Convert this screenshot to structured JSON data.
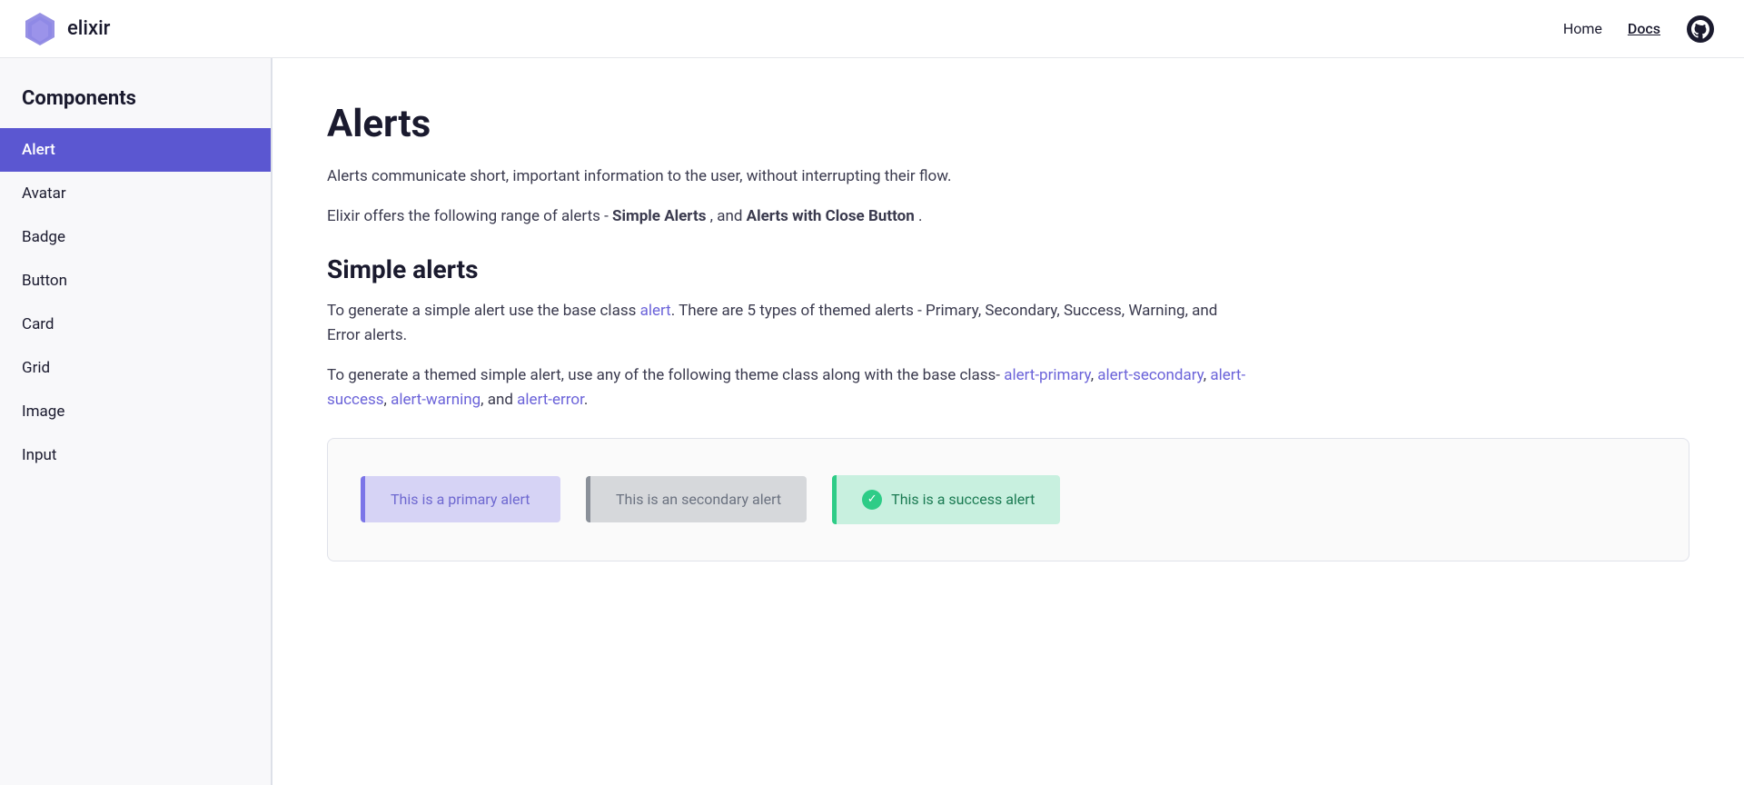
{
  "nav": {
    "logo_text": "elixir",
    "home_label": "Home",
    "docs_label": "Docs",
    "github_label": "GitHub"
  },
  "sidebar": {
    "heading": "Components",
    "items": [
      {
        "id": "alert",
        "label": "Alert",
        "active": true
      },
      {
        "id": "avatar",
        "label": "Avatar",
        "active": false
      },
      {
        "id": "badge",
        "label": "Badge",
        "active": false
      },
      {
        "id": "button",
        "label": "Button",
        "active": false
      },
      {
        "id": "card",
        "label": "Card",
        "active": false
      },
      {
        "id": "grid",
        "label": "Grid",
        "active": false
      },
      {
        "id": "image",
        "label": "Image",
        "active": false
      },
      {
        "id": "input",
        "label": "Input",
        "active": false
      }
    ]
  },
  "main": {
    "page_title": "Alerts",
    "page_description": "Alerts communicate short, important information to the user, without interrupting their flow.",
    "range_intro": "Elixir offers the following range of alerts - ",
    "range_simple": "Simple Alerts",
    "range_and": ", and ",
    "range_close": "Alerts with Close Button",
    "range_period": ".",
    "simple_title": "Simple alerts",
    "simple_desc_1": "To generate a simple alert use the base class ",
    "simple_desc_link": "alert",
    "simple_desc_2": ". There are 5 types of themed alerts - Primary, Secondary, Success, Warning, and Error alerts.",
    "themed_desc_1": "To generate a themed simple alert, use any of the following theme class along with the base class- ",
    "themed_link_primary": "alert-primary",
    "themed_comma1": ", ",
    "themed_link_secondary": "alert-secondary",
    "themed_comma2": ", ",
    "themed_link_success": "alert-success",
    "themed_comma3": ", ",
    "themed_link_warning": "alert-warning",
    "themed_and": ", and ",
    "themed_link_error": "alert-error",
    "themed_period": ".",
    "alerts": {
      "primary_text": "This is a primary alert",
      "secondary_text": "This is an secondary alert",
      "success_text": "This is a success alert",
      "success_icon": "✓"
    }
  }
}
